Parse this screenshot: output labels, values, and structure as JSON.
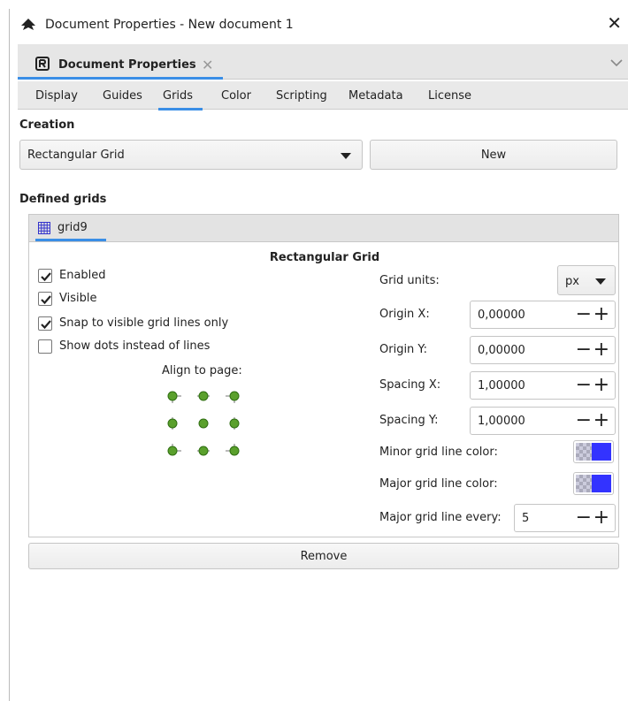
{
  "window": {
    "title": "Document Properties - New document 1",
    "close_glyph": "✕"
  },
  "dock": {
    "tab_label": "Document Properties",
    "tab_close": "✕",
    "chevron": "⌄"
  },
  "tabs": [
    "Display",
    "Guides",
    "Grids",
    "Color",
    "Scripting",
    "Metadata",
    "License"
  ],
  "active_tab": "Grids",
  "creation": {
    "heading": "Creation",
    "grid_type": "Rectangular Grid",
    "new_label": "New"
  },
  "defined": {
    "heading": "Defined grids",
    "grid_tab": "grid9"
  },
  "grid": {
    "title": "Rectangular Grid",
    "enabled_label": "Enabled",
    "enabled": true,
    "visible_label": "Visible",
    "visible": true,
    "snap_label": "Snap to visible grid lines only",
    "snap": true,
    "dots_label": "Show dots instead of lines",
    "dots": false,
    "align_label": "Align to page:",
    "units_label": "Grid units:",
    "units_value": "px",
    "origin_x_label": "Origin X:",
    "origin_x": "0,00000",
    "origin_y_label": "Origin Y:",
    "origin_y": "0,00000",
    "spacing_x_label": "Spacing X:",
    "spacing_x": "1,00000",
    "spacing_y_label": "Spacing Y:",
    "spacing_y": "1,00000",
    "minor_color_label": "Minor grid line color:",
    "minor_color": "#3333ff",
    "major_color_label": "Major grid line color:",
    "major_color": "#3333ff",
    "major_every_label": "Major grid line every:",
    "major_every": "5",
    "minus": "−",
    "plus": "+"
  },
  "remove_label": "Remove",
  "colors": {
    "accent": "#3a8ee6",
    "align_node": "#5aa02c"
  }
}
